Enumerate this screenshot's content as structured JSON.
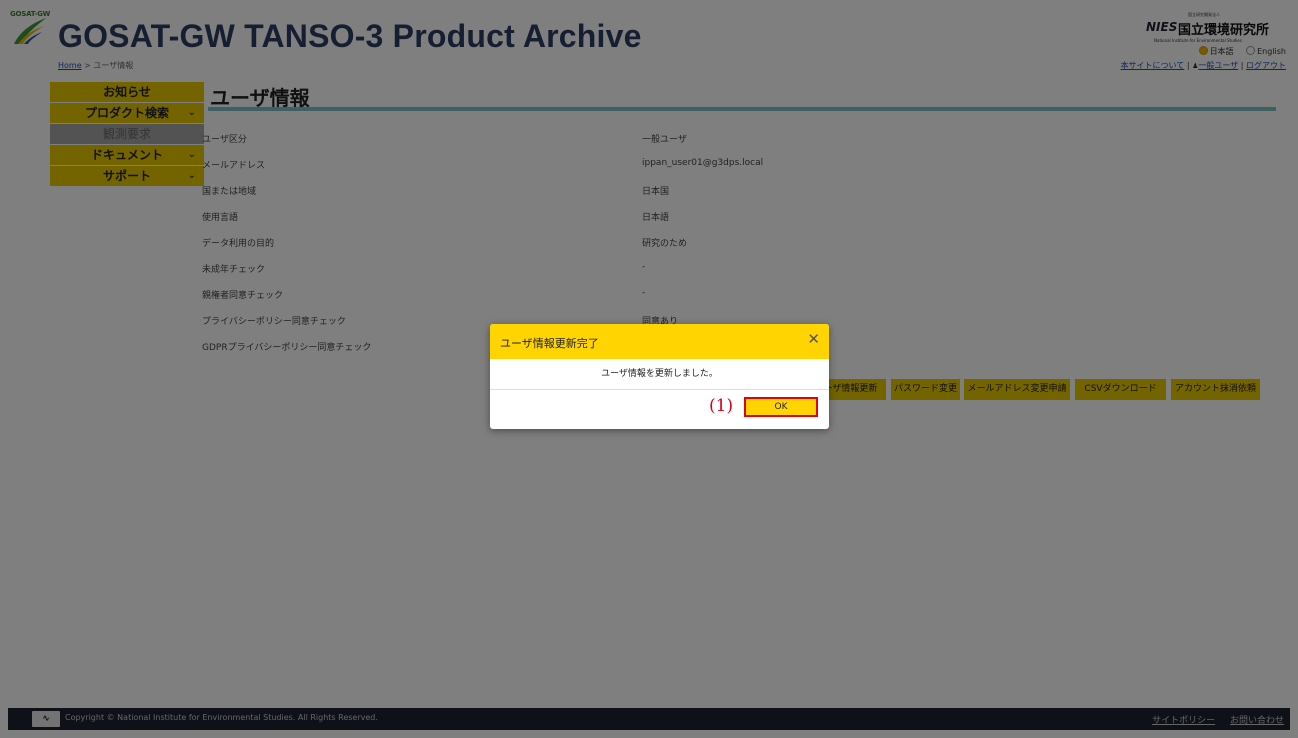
{
  "header": {
    "logo_text": "GOSAT-GW",
    "title": "GOSAT-GW TANSO-3 Product Archive",
    "breadcrumb": {
      "home": "Home",
      "sep": " > ",
      "current": "ユーザ情報"
    },
    "org": {
      "mark": "NIES",
      "small": "国立研究開発法人",
      "name": "国立環境研究所",
      "sub": "National Institute for Environmental Studies"
    },
    "languages": [
      {
        "label": "日本語",
        "selected": true
      },
      {
        "label": "English",
        "selected": false
      }
    ],
    "links": {
      "about": "本サイトについて",
      "sep1": " | ",
      "user": "一般ユーザ",
      "sep2": " | ",
      "logout": "ログアウト"
    }
  },
  "sidebar": {
    "items": [
      {
        "label": "お知らせ",
        "expandable": false,
        "disabled": false
      },
      {
        "label": "プロダクト検索",
        "expandable": true,
        "disabled": false
      },
      {
        "label": "観測要求",
        "expandable": false,
        "disabled": true
      },
      {
        "label": "ドキュメント",
        "expandable": true,
        "disabled": false
      },
      {
        "label": "サポート",
        "expandable": true,
        "disabled": false
      }
    ]
  },
  "main": {
    "title": "ユーザ情報",
    "rows": [
      {
        "label": "ユーザ区分",
        "value": "一般ユーザ"
      },
      {
        "label": "メールアドレス",
        "value": "ippan_user01@g3dps.local"
      },
      {
        "label": "国または地域",
        "value": "日本国"
      },
      {
        "label": "使用言語",
        "value": "日本語"
      },
      {
        "label": "データ利用の目的",
        "value": "研究のため"
      },
      {
        "label": "未成年チェック",
        "value": "-"
      },
      {
        "label": "親権者同意チェック",
        "value": "-"
      },
      {
        "label": "プライバシーポリシー同意チェック",
        "value": "同意あり"
      },
      {
        "label": "GDPRプライバシーポリシー同意チェック",
        "value": ""
      }
    ],
    "actions": [
      "ユーザ情報更新",
      "パスワード変更",
      "メールアドレス変更申請",
      "CSVダウンロード",
      "アカウント抹消依頼"
    ]
  },
  "footer": {
    "copyright": "Copyright © National Institute for Environmental Studies. All Rights Reserved.",
    "links": [
      "サイトポリシー",
      "お問い合わせ"
    ]
  },
  "modal": {
    "title": "ユーザ情報更新完了",
    "message": "ユーザ情報を更新しました。",
    "ok_label": "OK",
    "close_icon": "close-icon"
  },
  "annotation": {
    "callout": "(1)"
  },
  "colors": {
    "accent": "#ffd400",
    "sidebar": "#e8c800",
    "highlight": "#e3000f",
    "title_text": "#2c3e64",
    "footer": "#1d2330"
  }
}
